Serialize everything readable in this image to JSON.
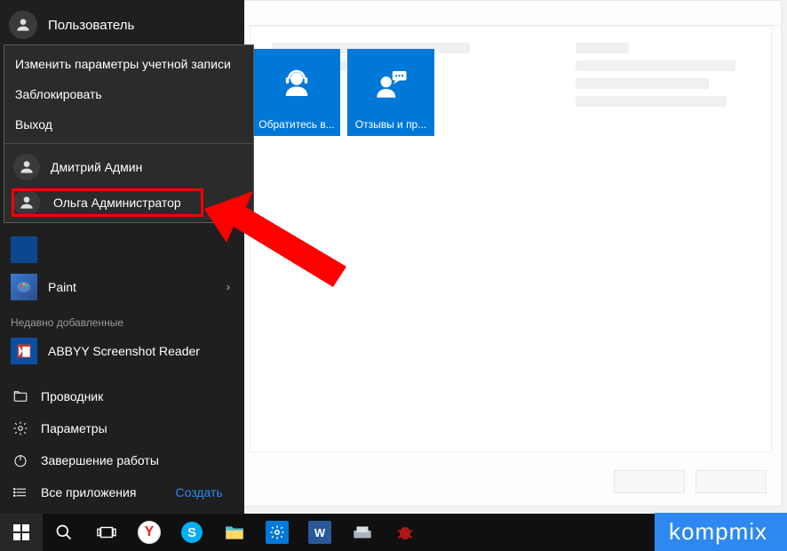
{
  "start_menu": {
    "current_user": "Пользователь",
    "popup": {
      "change_account_settings": "Изменить параметры учетной записи",
      "lock": "Заблокировать",
      "sign_out": "Выход",
      "users": [
        {
          "name": "Дмитрий Админ"
        },
        {
          "name": "Ольга Администратор"
        }
      ]
    },
    "apps": {
      "paint": "Paint",
      "recently_added_label": "Недавно добавленные",
      "abbyy": "ABBYY Screenshot Reader"
    },
    "system": {
      "file_explorer": "Проводник",
      "settings": "Параметры",
      "power": "Завершение работы",
      "all_apps": "Все приложения",
      "create": "Создать"
    }
  },
  "tiles": {
    "help": "Обратитесь в...",
    "feedback": "Отзывы и пр..."
  },
  "taskbar": {
    "items": [
      "start",
      "search",
      "task-view",
      "yandex",
      "skype",
      "explorer",
      "settings",
      "word",
      "scanner",
      "bug"
    ]
  },
  "watermark": "kompmix",
  "colors": {
    "accent": "#0078d7",
    "highlight": "#ff0000"
  }
}
